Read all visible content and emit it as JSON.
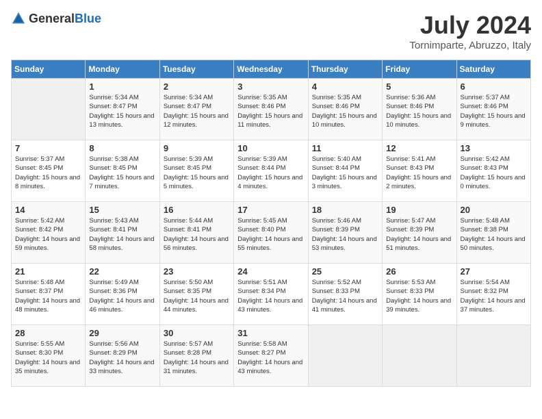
{
  "header": {
    "logo_general": "General",
    "logo_blue": "Blue",
    "month_year": "July 2024",
    "location": "Tornimparte, Abruzzo, Italy"
  },
  "days_of_week": [
    "Sunday",
    "Monday",
    "Tuesday",
    "Wednesday",
    "Thursday",
    "Friday",
    "Saturday"
  ],
  "weeks": [
    [
      {
        "num": "",
        "empty": true
      },
      {
        "num": "1",
        "sunrise": "Sunrise: 5:34 AM",
        "sunset": "Sunset: 8:47 PM",
        "daylight": "Daylight: 15 hours and 13 minutes."
      },
      {
        "num": "2",
        "sunrise": "Sunrise: 5:34 AM",
        "sunset": "Sunset: 8:47 PM",
        "daylight": "Daylight: 15 hours and 12 minutes."
      },
      {
        "num": "3",
        "sunrise": "Sunrise: 5:35 AM",
        "sunset": "Sunset: 8:46 PM",
        "daylight": "Daylight: 15 hours and 11 minutes."
      },
      {
        "num": "4",
        "sunrise": "Sunrise: 5:35 AM",
        "sunset": "Sunset: 8:46 PM",
        "daylight": "Daylight: 15 hours and 10 minutes."
      },
      {
        "num": "5",
        "sunrise": "Sunrise: 5:36 AM",
        "sunset": "Sunset: 8:46 PM",
        "daylight": "Daylight: 15 hours and 10 minutes."
      },
      {
        "num": "6",
        "sunrise": "Sunrise: 5:37 AM",
        "sunset": "Sunset: 8:46 PM",
        "daylight": "Daylight: 15 hours and 9 minutes."
      }
    ],
    [
      {
        "num": "7",
        "sunrise": "Sunrise: 5:37 AM",
        "sunset": "Sunset: 8:45 PM",
        "daylight": "Daylight: 15 hours and 8 minutes."
      },
      {
        "num": "8",
        "sunrise": "Sunrise: 5:38 AM",
        "sunset": "Sunset: 8:45 PM",
        "daylight": "Daylight: 15 hours and 7 minutes."
      },
      {
        "num": "9",
        "sunrise": "Sunrise: 5:39 AM",
        "sunset": "Sunset: 8:45 PM",
        "daylight": "Daylight: 15 hours and 5 minutes."
      },
      {
        "num": "10",
        "sunrise": "Sunrise: 5:39 AM",
        "sunset": "Sunset: 8:44 PM",
        "daylight": "Daylight: 15 hours and 4 minutes."
      },
      {
        "num": "11",
        "sunrise": "Sunrise: 5:40 AM",
        "sunset": "Sunset: 8:44 PM",
        "daylight": "Daylight: 15 hours and 3 minutes."
      },
      {
        "num": "12",
        "sunrise": "Sunrise: 5:41 AM",
        "sunset": "Sunset: 8:43 PM",
        "daylight": "Daylight: 15 hours and 2 minutes."
      },
      {
        "num": "13",
        "sunrise": "Sunrise: 5:42 AM",
        "sunset": "Sunset: 8:43 PM",
        "daylight": "Daylight: 15 hours and 0 minutes."
      }
    ],
    [
      {
        "num": "14",
        "sunrise": "Sunrise: 5:42 AM",
        "sunset": "Sunset: 8:42 PM",
        "daylight": "Daylight: 14 hours and 59 minutes."
      },
      {
        "num": "15",
        "sunrise": "Sunrise: 5:43 AM",
        "sunset": "Sunset: 8:41 PM",
        "daylight": "Daylight: 14 hours and 58 minutes."
      },
      {
        "num": "16",
        "sunrise": "Sunrise: 5:44 AM",
        "sunset": "Sunset: 8:41 PM",
        "daylight": "Daylight: 14 hours and 56 minutes."
      },
      {
        "num": "17",
        "sunrise": "Sunrise: 5:45 AM",
        "sunset": "Sunset: 8:40 PM",
        "daylight": "Daylight: 14 hours and 55 minutes."
      },
      {
        "num": "18",
        "sunrise": "Sunrise: 5:46 AM",
        "sunset": "Sunset: 8:39 PM",
        "daylight": "Daylight: 14 hours and 53 minutes."
      },
      {
        "num": "19",
        "sunrise": "Sunrise: 5:47 AM",
        "sunset": "Sunset: 8:39 PM",
        "daylight": "Daylight: 14 hours and 51 minutes."
      },
      {
        "num": "20",
        "sunrise": "Sunrise: 5:48 AM",
        "sunset": "Sunset: 8:38 PM",
        "daylight": "Daylight: 14 hours and 50 minutes."
      }
    ],
    [
      {
        "num": "21",
        "sunrise": "Sunrise: 5:48 AM",
        "sunset": "Sunset: 8:37 PM",
        "daylight": "Daylight: 14 hours and 48 minutes."
      },
      {
        "num": "22",
        "sunrise": "Sunrise: 5:49 AM",
        "sunset": "Sunset: 8:36 PM",
        "daylight": "Daylight: 14 hours and 46 minutes."
      },
      {
        "num": "23",
        "sunrise": "Sunrise: 5:50 AM",
        "sunset": "Sunset: 8:35 PM",
        "daylight": "Daylight: 14 hours and 44 minutes."
      },
      {
        "num": "24",
        "sunrise": "Sunrise: 5:51 AM",
        "sunset": "Sunset: 8:34 PM",
        "daylight": "Daylight: 14 hours and 43 minutes."
      },
      {
        "num": "25",
        "sunrise": "Sunrise: 5:52 AM",
        "sunset": "Sunset: 8:33 PM",
        "daylight": "Daylight: 14 hours and 41 minutes."
      },
      {
        "num": "26",
        "sunrise": "Sunrise: 5:53 AM",
        "sunset": "Sunset: 8:33 PM",
        "daylight": "Daylight: 14 hours and 39 minutes."
      },
      {
        "num": "27",
        "sunrise": "Sunrise: 5:54 AM",
        "sunset": "Sunset: 8:32 PM",
        "daylight": "Daylight: 14 hours and 37 minutes."
      }
    ],
    [
      {
        "num": "28",
        "sunrise": "Sunrise: 5:55 AM",
        "sunset": "Sunset: 8:30 PM",
        "daylight": "Daylight: 14 hours and 35 minutes."
      },
      {
        "num": "29",
        "sunrise": "Sunrise: 5:56 AM",
        "sunset": "Sunset: 8:29 PM",
        "daylight": "Daylight: 14 hours and 33 minutes."
      },
      {
        "num": "30",
        "sunrise": "Sunrise: 5:57 AM",
        "sunset": "Sunset: 8:28 PM",
        "daylight": "Daylight: 14 hours and 31 minutes."
      },
      {
        "num": "31",
        "sunrise": "Sunrise: 5:58 AM",
        "sunset": "Sunset: 8:27 PM",
        "daylight": "Daylight: 14 hours and 43 minutes."
      },
      {
        "num": "",
        "empty": true
      },
      {
        "num": "",
        "empty": true
      },
      {
        "num": "",
        "empty": true
      }
    ]
  ]
}
